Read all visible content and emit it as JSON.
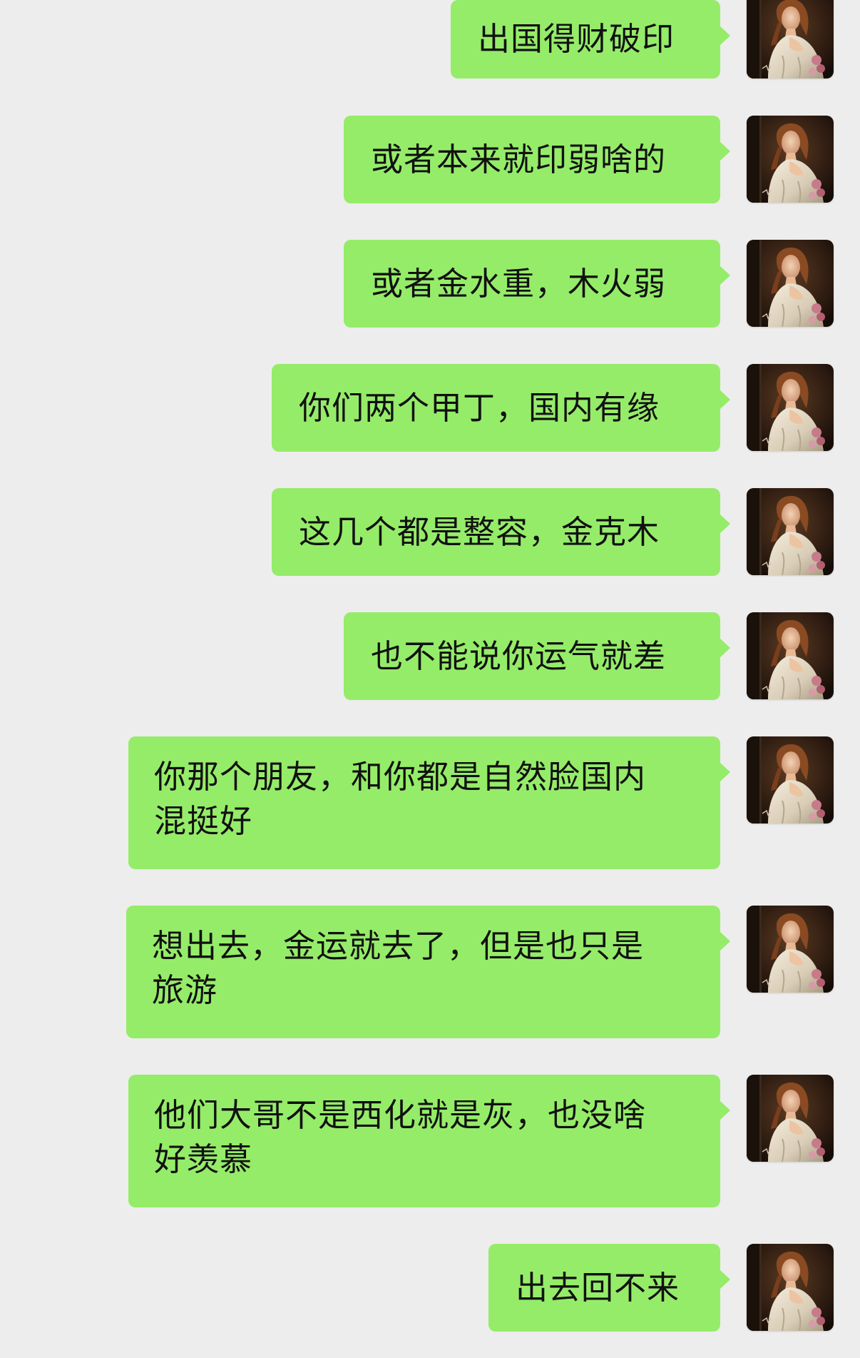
{
  "messages": [
    {
      "text": "出国得财破印",
      "sender": "self",
      "avatar_icon": "portrait-painting-avatar-icon"
    },
    {
      "text": "或者本来就印弱啥的",
      "sender": "self",
      "avatar_icon": "portrait-painting-avatar-icon"
    },
    {
      "text": "或者金水重，木火弱",
      "sender": "self",
      "avatar_icon": "portrait-painting-avatar-icon"
    },
    {
      "text": "你们两个甲丁，国内有缘",
      "sender": "self",
      "avatar_icon": "portrait-painting-avatar-icon"
    },
    {
      "text": "这几个都是整容，金克木",
      "sender": "self",
      "avatar_icon": "portrait-painting-avatar-icon"
    },
    {
      "text": "也不能说你运气就差",
      "sender": "self",
      "avatar_icon": "portrait-painting-avatar-icon"
    },
    {
      "line1": "你那个朋友，和你都是自然脸国内",
      "line2": "混挺好",
      "sender": "self",
      "avatar_icon": "portrait-painting-avatar-icon"
    },
    {
      "line1": "想出去，金运就去了，但是也只是",
      "line2": "旅游",
      "sender": "self",
      "avatar_icon": "portrait-painting-avatar-icon"
    },
    {
      "line1": "他们大哥不是西化就是灰，也没啥",
      "line2": "好羡慕",
      "sender": "self",
      "avatar_icon": "portrait-painting-avatar-icon"
    },
    {
      "text": "出去回不来",
      "sender": "self",
      "avatar_icon": "portrait-painting-avatar-icon"
    }
  ],
  "colors": {
    "background": "#ededed",
    "bubble_self": "#95ec69",
    "text": "#111111"
  }
}
